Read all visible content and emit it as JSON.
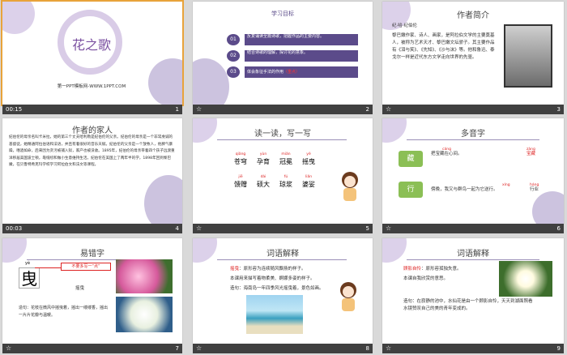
{
  "slides": [
    {
      "title": "花之歌",
      "footer": "第一PPT模板网-WWW.1PPT.COM",
      "time": "00:15",
      "num": "1"
    },
    {
      "heading": "学习目标",
      "goals": [
        {
          "n": "01",
          "text": "反复诵读全篇诗歌，把握作品的主要内容。"
        },
        {
          "n": "02",
          "text": "结合诗歌的理解，探讨花的意象。"
        },
        {
          "n": "03",
          "text": "体会象征手法的作用"
        }
      ],
      "goal3_mark": "（重点）",
      "num": "2"
    },
    {
      "heading": "作者简介",
      "paras": [
        "纪·哈·纪伯伦",
        "黎巴嫩作家、诗人、画家，是阿拉伯文学的主要奠基人，被称为艺术天才、黎巴嫩文坛骄子。其主要作品有《泪与笑》、《先知》、《沙与沫》等。他和鲁迅、泰戈尔一样是近代东方文学走向世界的先驱。"
      ],
      "num": "3"
    },
    {
      "heading": "作者的家人",
      "body": "纪伯伦的母亲名叫卡米拉，她的第三个丈夫哈利勒是纪伯伦的父亲。纪伯伦的母亲是一个非常虔诚的基督徒，她精通阿拉伯语和法语，并且有着很好的音乐天赋。纪伯伦的父亲是一个放牧人，他脾气暴躁，嗜酒如命，后来因为贪污被捕入狱，家产也被没收。1895年，纪伯伦的母亲带着四个孩子远渡重洋移居美国波士顿，靠缝纫和做小生意维持生活。纪伯伦在美国上了两年半的学，1898年回到黎巴嫩，在贝鲁特希克玛学校学习阿拉伯文和法文等课程。",
      "time": "00:03",
      "num": "4"
    },
    {
      "heading": "读一读，写一写",
      "words1": [
        {
          "py": "qiǎng",
          "w": "苍穹"
        },
        {
          "py": "yùn",
          "w": "孕育"
        },
        {
          "py": "miǎn",
          "w": "冠冕"
        },
        {
          "py": "yè",
          "w": "摇曳"
        }
      ],
      "words2": [
        {
          "py": "jiē",
          "w": "馈赠"
        },
        {
          "py": "dài",
          "w": "硕大"
        },
        {
          "py": "fú",
          "w": "琼浆"
        },
        {
          "py": "liǎn",
          "w": "婆娑"
        }
      ],
      "num": "5"
    },
    {
      "heading": "多音字",
      "items": [
        {
          "char": "藏",
          "line": "把宝藏在心间。",
          "py1": "cáng",
          "alt": "宝藏",
          "py2": "zàng"
        },
        {
          "char": "行",
          "line": "傍晚，我又与群鸟一起为它送行。",
          "py1": "xíng",
          "alt": "行业",
          "py2": "háng"
        }
      ],
      "num": "6"
    },
    {
      "heading": "易错字",
      "big_char": "曳",
      "big_py": "yè",
      "callout": "不要多写一“点”",
      "word": "摇曳",
      "example": "造句：花枝在微风中摇曳着，摇出一缕缕香，摇出一片片花瓣与温暖。",
      "num": "7"
    },
    {
      "heading": "词语解释",
      "term": "摇曳",
      "def": "：原形容为连续随风飘扬的样子。",
      "more": "本课用来描写着物柔美、婀娜多姿的样子。",
      "example": "造句：海南岛一年四季风光摇曳着，景色如画。",
      "num": "8"
    },
    {
      "heading": "词语解释",
      "term": "顾影自怜",
      "def": "：原形容孤独失意。",
      "more": "本课自我欣赏的意思。",
      "example": "造句：在寂静的池中，水仙花是由一个顾影自怜，天天到湖面照看水镜赞叹自己的美的青年变成的。",
      "num": "9"
    }
  ]
}
